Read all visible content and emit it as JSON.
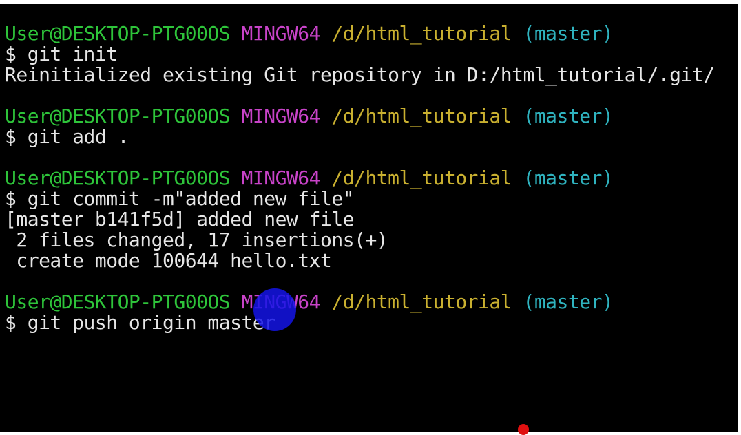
{
  "prompts": [
    {
      "user": "User@DESKTOP-PTG00OS",
      "system": "MINGW64",
      "path": "/d/html_tutorial",
      "branch": "(master)"
    },
    {
      "user": "User@DESKTOP-PTG00OS",
      "system": "MINGW64",
      "path": "/d/html_tutorial",
      "branch": "(master)"
    },
    {
      "user": "User@DESKTOP-PTG00OS",
      "system": "MINGW64",
      "path": "/d/html_tutorial",
      "branch": "(master)"
    },
    {
      "user": "User@DESKTOP-PTG00OS",
      "system": "MINGW64",
      "path": "/d/html_tutorial",
      "branch": "(master)"
    }
  ],
  "commands": [
    "$ git init",
    "$ git add .",
    "$ git commit -m\"added new file\"",
    "$ git push origin master"
  ],
  "outputs": {
    "init": "Reinitialized existing Git repository in D:/html_tutorial/.git/",
    "commit": [
      "[master b141f5d] added new file",
      " 2 files changed, 17 insertions(+)",
      " create mode 100644 hello.txt"
    ]
  },
  "colors": {
    "background": "#000000",
    "text": "#e6e6e6",
    "user": "#2ec43a",
    "system": "#c843c8",
    "path": "#c9b030",
    "branch": "#2fb3bf",
    "cursor_highlight": "#1414e6"
  }
}
